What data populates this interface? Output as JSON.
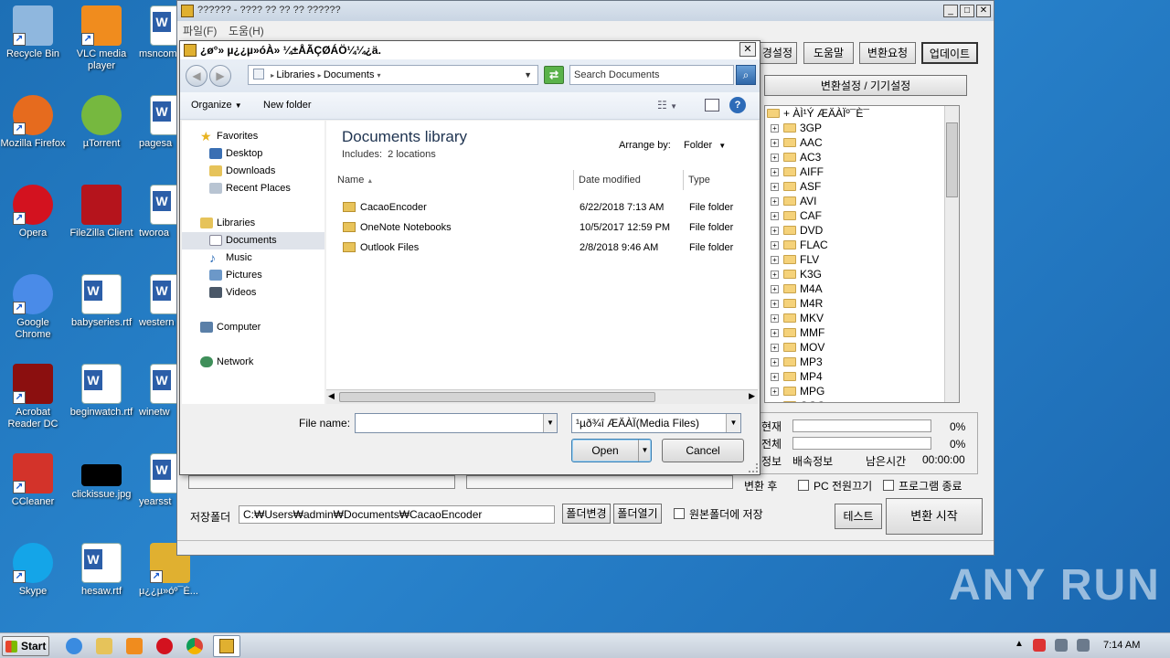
{
  "desktop": {
    "icons": [
      {
        "label": "Recycle Bin",
        "icon": "recycle-bin-icon"
      },
      {
        "label": "VLC media player",
        "icon": "vlc-icon"
      },
      {
        "label": "msncom",
        "icon": "word-doc-icon"
      },
      {
        "label": "Mozilla Firefox",
        "icon": "firefox-icon"
      },
      {
        "label": "µTorrent",
        "icon": "utorrent-icon"
      },
      {
        "label": "pagesa",
        "icon": "word-doc-icon"
      },
      {
        "label": "Opera",
        "icon": "opera-icon"
      },
      {
        "label": "FileZilla Client",
        "icon": "filezilla-icon"
      },
      {
        "label": "tworoa",
        "icon": "word-doc-icon"
      },
      {
        "label": "Google Chrome",
        "icon": "chrome-icon"
      },
      {
        "label": "babyseries.rtf",
        "icon": "word-doc-icon"
      },
      {
        "label": "western",
        "icon": "word-doc-icon"
      },
      {
        "label": "Acrobat Reader DC",
        "icon": "acrobat-icon"
      },
      {
        "label": "beginwatch.rtf",
        "icon": "word-doc-icon"
      },
      {
        "label": "winetw",
        "icon": "word-doc-icon"
      },
      {
        "label": "CCleaner",
        "icon": "ccleaner-icon"
      },
      {
        "label": "clickissue.jpg",
        "icon": "image-icon"
      },
      {
        "label": "yearsst",
        "icon": "word-doc-icon"
      },
      {
        "label": "Skype",
        "icon": "skype-icon"
      },
      {
        "label": "hesaw.rtf",
        "icon": "word-doc-icon"
      },
      {
        "label": "µ¿¿µ»óº¯È...",
        "icon": "cacao-encoder-icon"
      }
    ],
    "watermark": "ANY RUN"
  },
  "app": {
    "title": "?????? - ???? ?? ?? ?? ??????",
    "menu": [
      "파일(F)",
      "도움(H)"
    ],
    "top_buttons": [
      "경설정",
      "도움말",
      "변환요청",
      "업데이트"
    ],
    "settings_header": "변환설정 / 기기설정",
    "tree_root": "+ ÀÌ¹Ý ÆÄÀÏº¯È¯",
    "formats": [
      "3GP",
      "AAC",
      "AC3",
      "AIFF",
      "ASF",
      "AVI",
      "CAF",
      "DVD",
      "FLAC",
      "FLV",
      "K3G",
      "M4A",
      "M4R",
      "MKV",
      "MMF",
      "MOV",
      "MP3",
      "MP4",
      "MPG",
      "OGG"
    ],
    "progress": {
      "current_label": "현재",
      "total_label": "전체",
      "current_pct": "0%",
      "total_pct": "0%",
      "current_value": 0,
      "total_value": 0,
      "info_label": "정보",
      "speed_label": "배속정보",
      "remaining_label": "남은시간",
      "remaining_value": "00:00:00"
    },
    "after_label": "변환 후",
    "pc_off_label": "PC 전원끄기",
    "exit_label": "프로그램 종료",
    "save_folder_label": "저장폴더",
    "save_folder_value": "C:₩Users₩admin₩Documents₩CacaoEncoder",
    "change_folder": "폴더변경",
    "open_folder": "폴더열기",
    "save_in_source": "원본폴더에 저장",
    "test_button": "테스트",
    "start_button": "변환 시작"
  },
  "dialog": {
    "title": "¿ø°» µ¿¿µ»óÀ» ¼±ÅÃÇØÁÖ¼¼¿ä.",
    "breadcrumb": [
      "Libraries",
      "Documents"
    ],
    "search_placeholder": "Search Documents",
    "organize": "Organize",
    "new_folder": "New folder",
    "nav": {
      "favorites": "Favorites",
      "fav_items": [
        "Desktop",
        "Downloads",
        "Recent Places"
      ],
      "libraries": "Libraries",
      "lib_items": [
        "Documents",
        "Music",
        "Pictures",
        "Videos"
      ],
      "computer": "Computer",
      "network": "Network"
    },
    "library_title": "Documents library",
    "library_sub": "Includes:  2 locations",
    "arrange_label": "Arrange by:",
    "arrange_value": "Folder",
    "columns": [
      "Name",
      "Date modified",
      "Type"
    ],
    "files": [
      {
        "name": "CacaoEncoder",
        "date": "6/22/2018 7:13 AM",
        "type": "File folder"
      },
      {
        "name": "OneNote Notebooks",
        "date": "10/5/2017 12:59 PM",
        "type": "File folder"
      },
      {
        "name": "Outlook Files",
        "date": "2/8/2018 9:46 AM",
        "type": "File folder"
      }
    ],
    "file_name_label": "File name:",
    "file_name_value": "",
    "filter": "¹µð¾î ÆÄÀÏ(Media Files)",
    "open": "Open",
    "cancel": "Cancel"
  },
  "taskbar": {
    "start": "Start",
    "time": "7:14 AM"
  }
}
